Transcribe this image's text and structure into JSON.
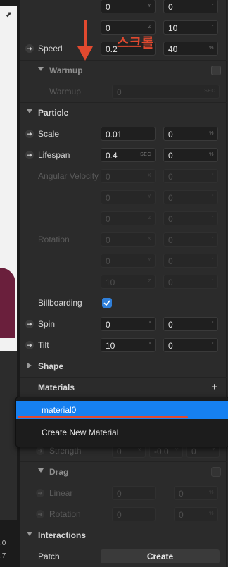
{
  "left_pane": {
    "bottom_numbers": [
      ".0",
      ".7"
    ]
  },
  "annotation": {
    "text": "스크롤",
    "color": "#e1492f"
  },
  "top_rows": [
    {
      "v1": "0",
      "s1": "Y",
      "v2": "0",
      "s2": "°"
    },
    {
      "v1": "0",
      "s1": "Z",
      "v2": "10",
      "s2": "°"
    }
  ],
  "speed": {
    "label": "Speed",
    "v1": "0.2",
    "v2": "40",
    "s2": "%"
  },
  "warmup": {
    "header": "Warmup",
    "label": "Warmup",
    "value": "0",
    "suffix": "SEC"
  },
  "particle": {
    "header": "Particle",
    "scale": {
      "label": "Scale",
      "v1": "0.01",
      "v2": "0",
      "s2": "%"
    },
    "lifespan": {
      "label": "Lifespan",
      "v1": "0.4",
      "s1": "SEC",
      "v2": "0",
      "s2": "%"
    },
    "angular_velocity": {
      "label": "Angular Velocity",
      "rows": [
        {
          "v1": "0",
          "s1": "X",
          "v2": "0",
          "s2": "°"
        },
        {
          "v1": "0",
          "s1": "Y",
          "v2": "0",
          "s2": "°"
        },
        {
          "v1": "0",
          "s1": "Z",
          "v2": "0",
          "s2": "°"
        }
      ]
    },
    "rotation": {
      "label": "Rotation",
      "rows": [
        {
          "v1": "0",
          "s1": "X",
          "v2": "0",
          "s2": "°"
        },
        {
          "v1": "0",
          "s1": "Y",
          "v2": "0",
          "s2": "°"
        },
        {
          "v1": "10",
          "s1": "Z",
          "v2": "0",
          "s2": "°"
        }
      ]
    },
    "billboarding": {
      "label": "Billboarding",
      "checked": true
    },
    "spin": {
      "label": "Spin",
      "v1": "0",
      "s1": "°",
      "v2": "0",
      "s2": "°"
    },
    "tilt": {
      "label": "Tilt",
      "v1": "10",
      "s1": "°",
      "v2": "0",
      "s2": "°"
    }
  },
  "shape": {
    "header": "Shape"
  },
  "materials": {
    "header": "Materials",
    "add": "+"
  },
  "menu": {
    "items": [
      "material0",
      "Create New Material"
    ]
  },
  "strength": {
    "label": "Strength",
    "v1": "0",
    "s1": "X",
    "v2": "-0.0",
    "s2": "Y",
    "v3": "0",
    "s3": "Z"
  },
  "drag": {
    "header": "Drag",
    "linear": {
      "label": "Linear",
      "v1": "0",
      "v2": "0",
      "s2": "%"
    },
    "rotation": {
      "label": "Rotation",
      "v1": "0",
      "v2": "0",
      "s2": "%"
    }
  },
  "interactions": {
    "header": "Interactions",
    "patch_label": "Patch",
    "button": "Create"
  }
}
